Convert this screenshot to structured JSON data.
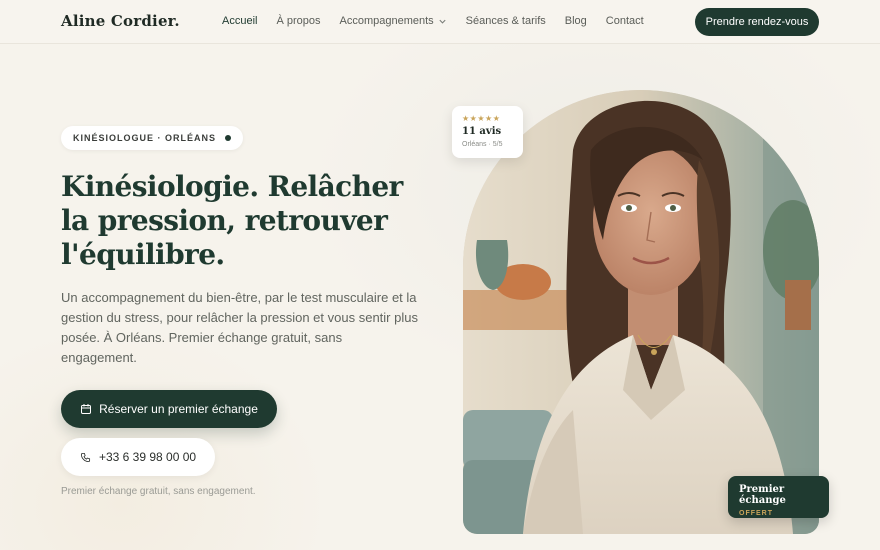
{
  "brand": {
    "logo": "Aline Cordier."
  },
  "nav": {
    "items": [
      {
        "label": "Accueil",
        "active": true
      },
      {
        "label": "À propos",
        "active": false
      },
      {
        "label": "Accompagnements",
        "active": false,
        "dropdown": true
      },
      {
        "label": "Séances & tarifs",
        "active": false
      },
      {
        "label": "Blog",
        "active": false
      },
      {
        "label": "Contact",
        "active": false
      }
    ],
    "cta_label": "Prendre rendez-vous"
  },
  "hero": {
    "badge": "KINÉSIOLOGUE · ORLÉANS",
    "title": "Kinésiologie. Relâcher la pression, retrouver l'équilibre.",
    "description": "Un accompagnement du bien-être, par le test musculaire et la gestion du stress, pour relâcher la pression et vous sentir plus posée. À Orléans. Premier échange gratuit, sans engagement.",
    "primary_button": "Réserver un premier échange",
    "phone_button": "+33 6 39 98 00 00",
    "note": "Premier échange gratuit, sans engagement."
  },
  "review": {
    "stars": "★★★★★",
    "rating_value": 5,
    "count": "11 avis",
    "sub": "Orléans · 5/5"
  },
  "offer": {
    "title": "Premier échange",
    "sub": "OFFERT"
  },
  "colors": {
    "accent": "#1f3a30",
    "background": "#f6f3ec",
    "gold": "#c9a45a"
  },
  "icons": {
    "calendar": "calendar-icon",
    "phone": "phone-icon",
    "chevron": "chevron-down-icon",
    "badge_dot": "status-dot-icon"
  }
}
